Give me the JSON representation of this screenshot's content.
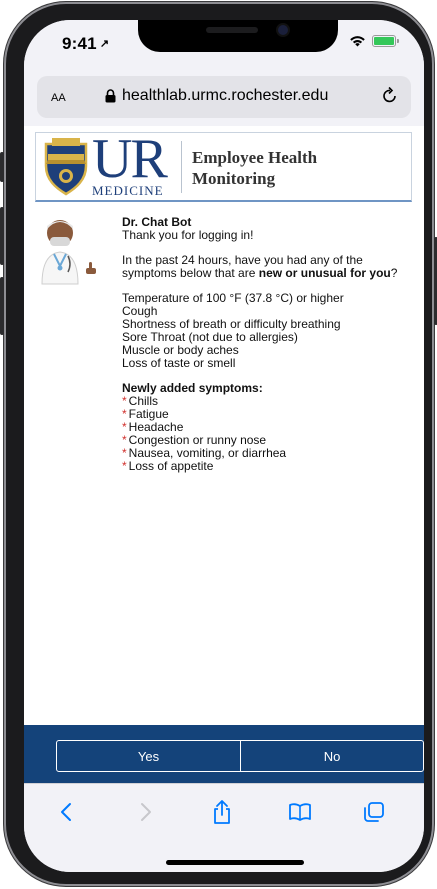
{
  "status_bar": {
    "time": "9:41",
    "location_arrow": "↗"
  },
  "address_bar": {
    "text_size_label": "AA",
    "url": "healthlab.urmc.rochester.edu"
  },
  "header": {
    "logo_letters": "UR",
    "logo_subtitle": "MEDICINE",
    "title_line1": "Employee Health",
    "title_line2": "Monitoring"
  },
  "message": {
    "sender": "Dr. Chat Bot",
    "greeting": "Thank you for logging in!",
    "question_before": "In the past 24 hours, have you had any of the symptoms below that are ",
    "question_bold": "new or unusual for you",
    "question_after": "?",
    "symptoms": [
      "Temperature of 100 °F (37.8 °C) or higher",
      "Cough",
      "Shortness of breath or difficulty breathing",
      "Sore Throat (not due to allergies)",
      "Muscle or body aches",
      "Loss of taste or smell"
    ],
    "new_symptoms_title": "Newly added symptoms:",
    "new_symptoms": [
      "Chills",
      "Fatigue",
      "Headache",
      "Congestion or runny nose",
      "Nausea, vomiting, or diarrhea",
      "Loss of appetite"
    ],
    "star": "*"
  },
  "responses": {
    "yes_label": "Yes",
    "no_label": "No"
  },
  "toolbar": {
    "icons": [
      "back-icon",
      "forward-icon",
      "share-icon",
      "bookmarks-icon",
      "tabs-icon"
    ]
  },
  "colors": {
    "brand_blue": "#14437a",
    "accent_link": "#007aff",
    "star_red": "#d0312d",
    "battery_green": "#34c759"
  }
}
